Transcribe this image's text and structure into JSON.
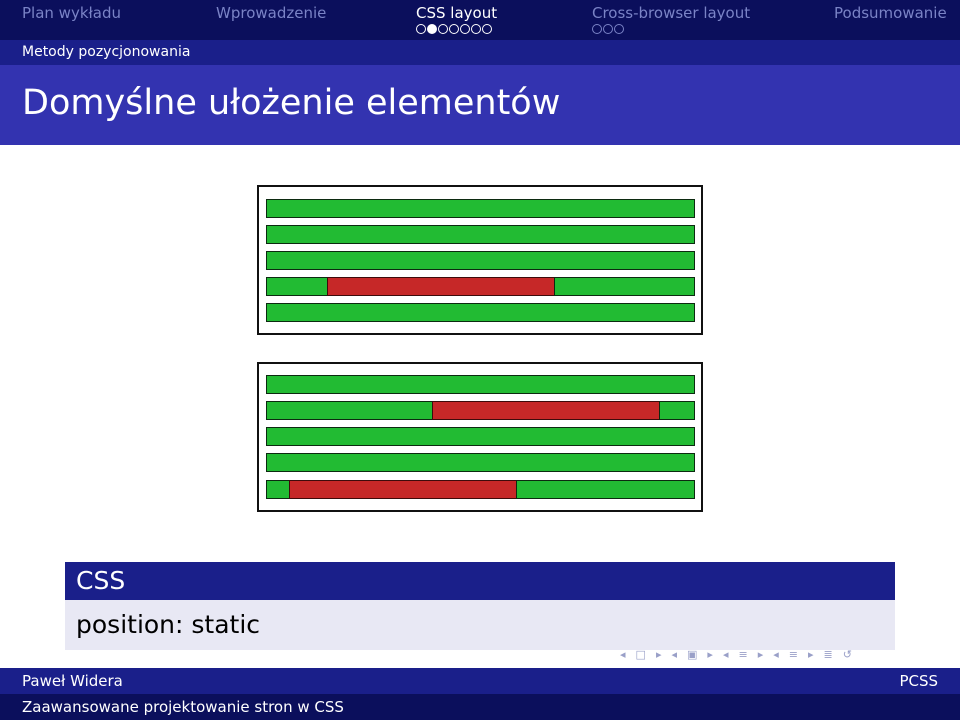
{
  "nav": {
    "sections": [
      {
        "label": "Plan wykładu",
        "active": false
      },
      {
        "label": "Wprowadzenie",
        "active": false
      },
      {
        "label": "CSS layout",
        "active": true
      },
      {
        "label": "Cross-browser layout",
        "active": false
      },
      {
        "label": "Podsumowanie",
        "active": false
      }
    ],
    "css_layout_slides": 7,
    "css_layout_current": 2,
    "cross_browser_slides": 3
  },
  "subsection": "Metody pozycjonowania",
  "frame_title": "Domyślne ułożenie elementów",
  "colors": {
    "block_element": "#22bb33",
    "inline_element": "#c62828",
    "header_dark": "#0b0f5c",
    "header_mid": "#1a1f8a",
    "title_bg": "#3333b0"
  },
  "block": {
    "title": "CSS",
    "body": "position: static"
  },
  "footer": {
    "author": "Paweł Widera",
    "short_title": "PCSS",
    "title": "Zaawansowane projektowanie stron w CSS"
  },
  "nav_symbols": [
    "arrow-left-icon",
    "frame-icon",
    "arrow-right-icon",
    "arrow-left-icon",
    "subsection-icon",
    "arrow-right-icon",
    "arrow-left-icon",
    "section-icon",
    "arrow-right-icon",
    "arrow-left-icon",
    "document-icon",
    "arrow-right-icon",
    "align-icon",
    "search-icon"
  ]
}
